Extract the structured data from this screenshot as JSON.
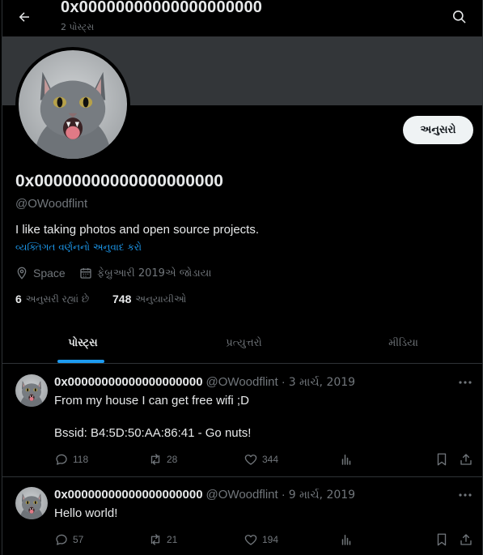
{
  "header": {
    "title": "0x00000000000000000000",
    "post_count": "2 પોસ્ટ્સ"
  },
  "profile": {
    "display_name": "0x00000000000000000000",
    "handle": "@OWoodflint",
    "bio": "I like taking photos and open source projects.",
    "translate_bio": "વ્યક્તિગત વર્ણનનો અનુવાદ કરો",
    "location": "Space",
    "joined": "ફેબ્રુઆરી 2019એ જોડાયા",
    "follow_label": "અનુસરો",
    "following_count": "6",
    "following_label": "અનુસરી રહ્યાં છે",
    "followers_count": "748",
    "followers_label": "અનુયાયીઓ"
  },
  "tabs": [
    {
      "label": "પોસ્ટ્સ",
      "active": true
    },
    {
      "label": "પ્રત્યુત્તરો",
      "active": false
    },
    {
      "label": "મીડિયા",
      "active": false
    }
  ],
  "posts": [
    {
      "name": "0x00000000000000000000",
      "handle": "@OWoodflint",
      "date": "3 માર્ચ, 2019",
      "line1": "From my house I can get free wifi ;D",
      "line2": "Bssid: B4:5D:50:AA:86:41 - Go nuts!",
      "replies": "118",
      "reposts": "28",
      "likes": "344"
    },
    {
      "name": "0x00000000000000000000",
      "handle": "@OWoodflint",
      "date": "9 માર્ચ, 2019",
      "line1": "Hello world!",
      "replies": "57",
      "reposts": "21",
      "likes": "194"
    }
  ],
  "icons": {
    "back": "arrow-left-icon",
    "search": "search-icon",
    "location": "location-pin-icon",
    "calendar": "calendar-icon",
    "reply": "reply-icon",
    "repost": "repost-icon",
    "like": "heart-icon",
    "views": "views-chart-icon",
    "bookmark": "bookmark-icon",
    "share": "share-icon",
    "more": "more-icon"
  },
  "colors": {
    "accent": "#1d9bf0",
    "banner": "#333639",
    "muted": "#71767b"
  }
}
